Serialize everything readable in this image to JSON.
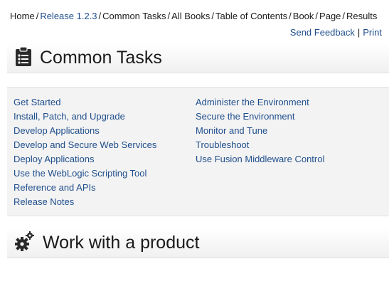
{
  "breadcrumb": [
    {
      "label": "Home",
      "style": "plain"
    },
    {
      "label": "Release 1.2.3",
      "style": "blue"
    },
    {
      "label": "Common Tasks",
      "style": "plain"
    },
    {
      "label": "All Books",
      "style": "plain"
    },
    {
      "label": "Table of Contents",
      "style": "plain"
    },
    {
      "label": "Book",
      "style": "plain"
    },
    {
      "label": "Page",
      "style": "plain"
    },
    {
      "label": "Results",
      "style": "plain"
    }
  ],
  "actions": {
    "feedback": "Send Feedback",
    "separator": "|",
    "print": "Print"
  },
  "sections": {
    "common_tasks": {
      "title": "Common Tasks",
      "icon": "clipboard-icon",
      "left_links": [
        "Get Started",
        "Install, Patch, and Upgrade",
        "Develop Applications",
        "Develop and Secure Web Services",
        "Deploy Applications",
        "Use the WebLogic Scripting Tool",
        "Reference and APIs",
        "Release Notes"
      ],
      "right_links": [
        "Administer the Environment",
        "Secure the Environment",
        "Monitor and Tune",
        "Troubleshoot",
        "Use Fusion Middleware Control"
      ]
    },
    "work_with_product": {
      "title": "Work with a product",
      "icon": "gears-icon"
    }
  },
  "colors": {
    "link": "#1f4e8c",
    "panel_bg": "#f3f3f3",
    "icon_dark": "#2b2b2b"
  }
}
